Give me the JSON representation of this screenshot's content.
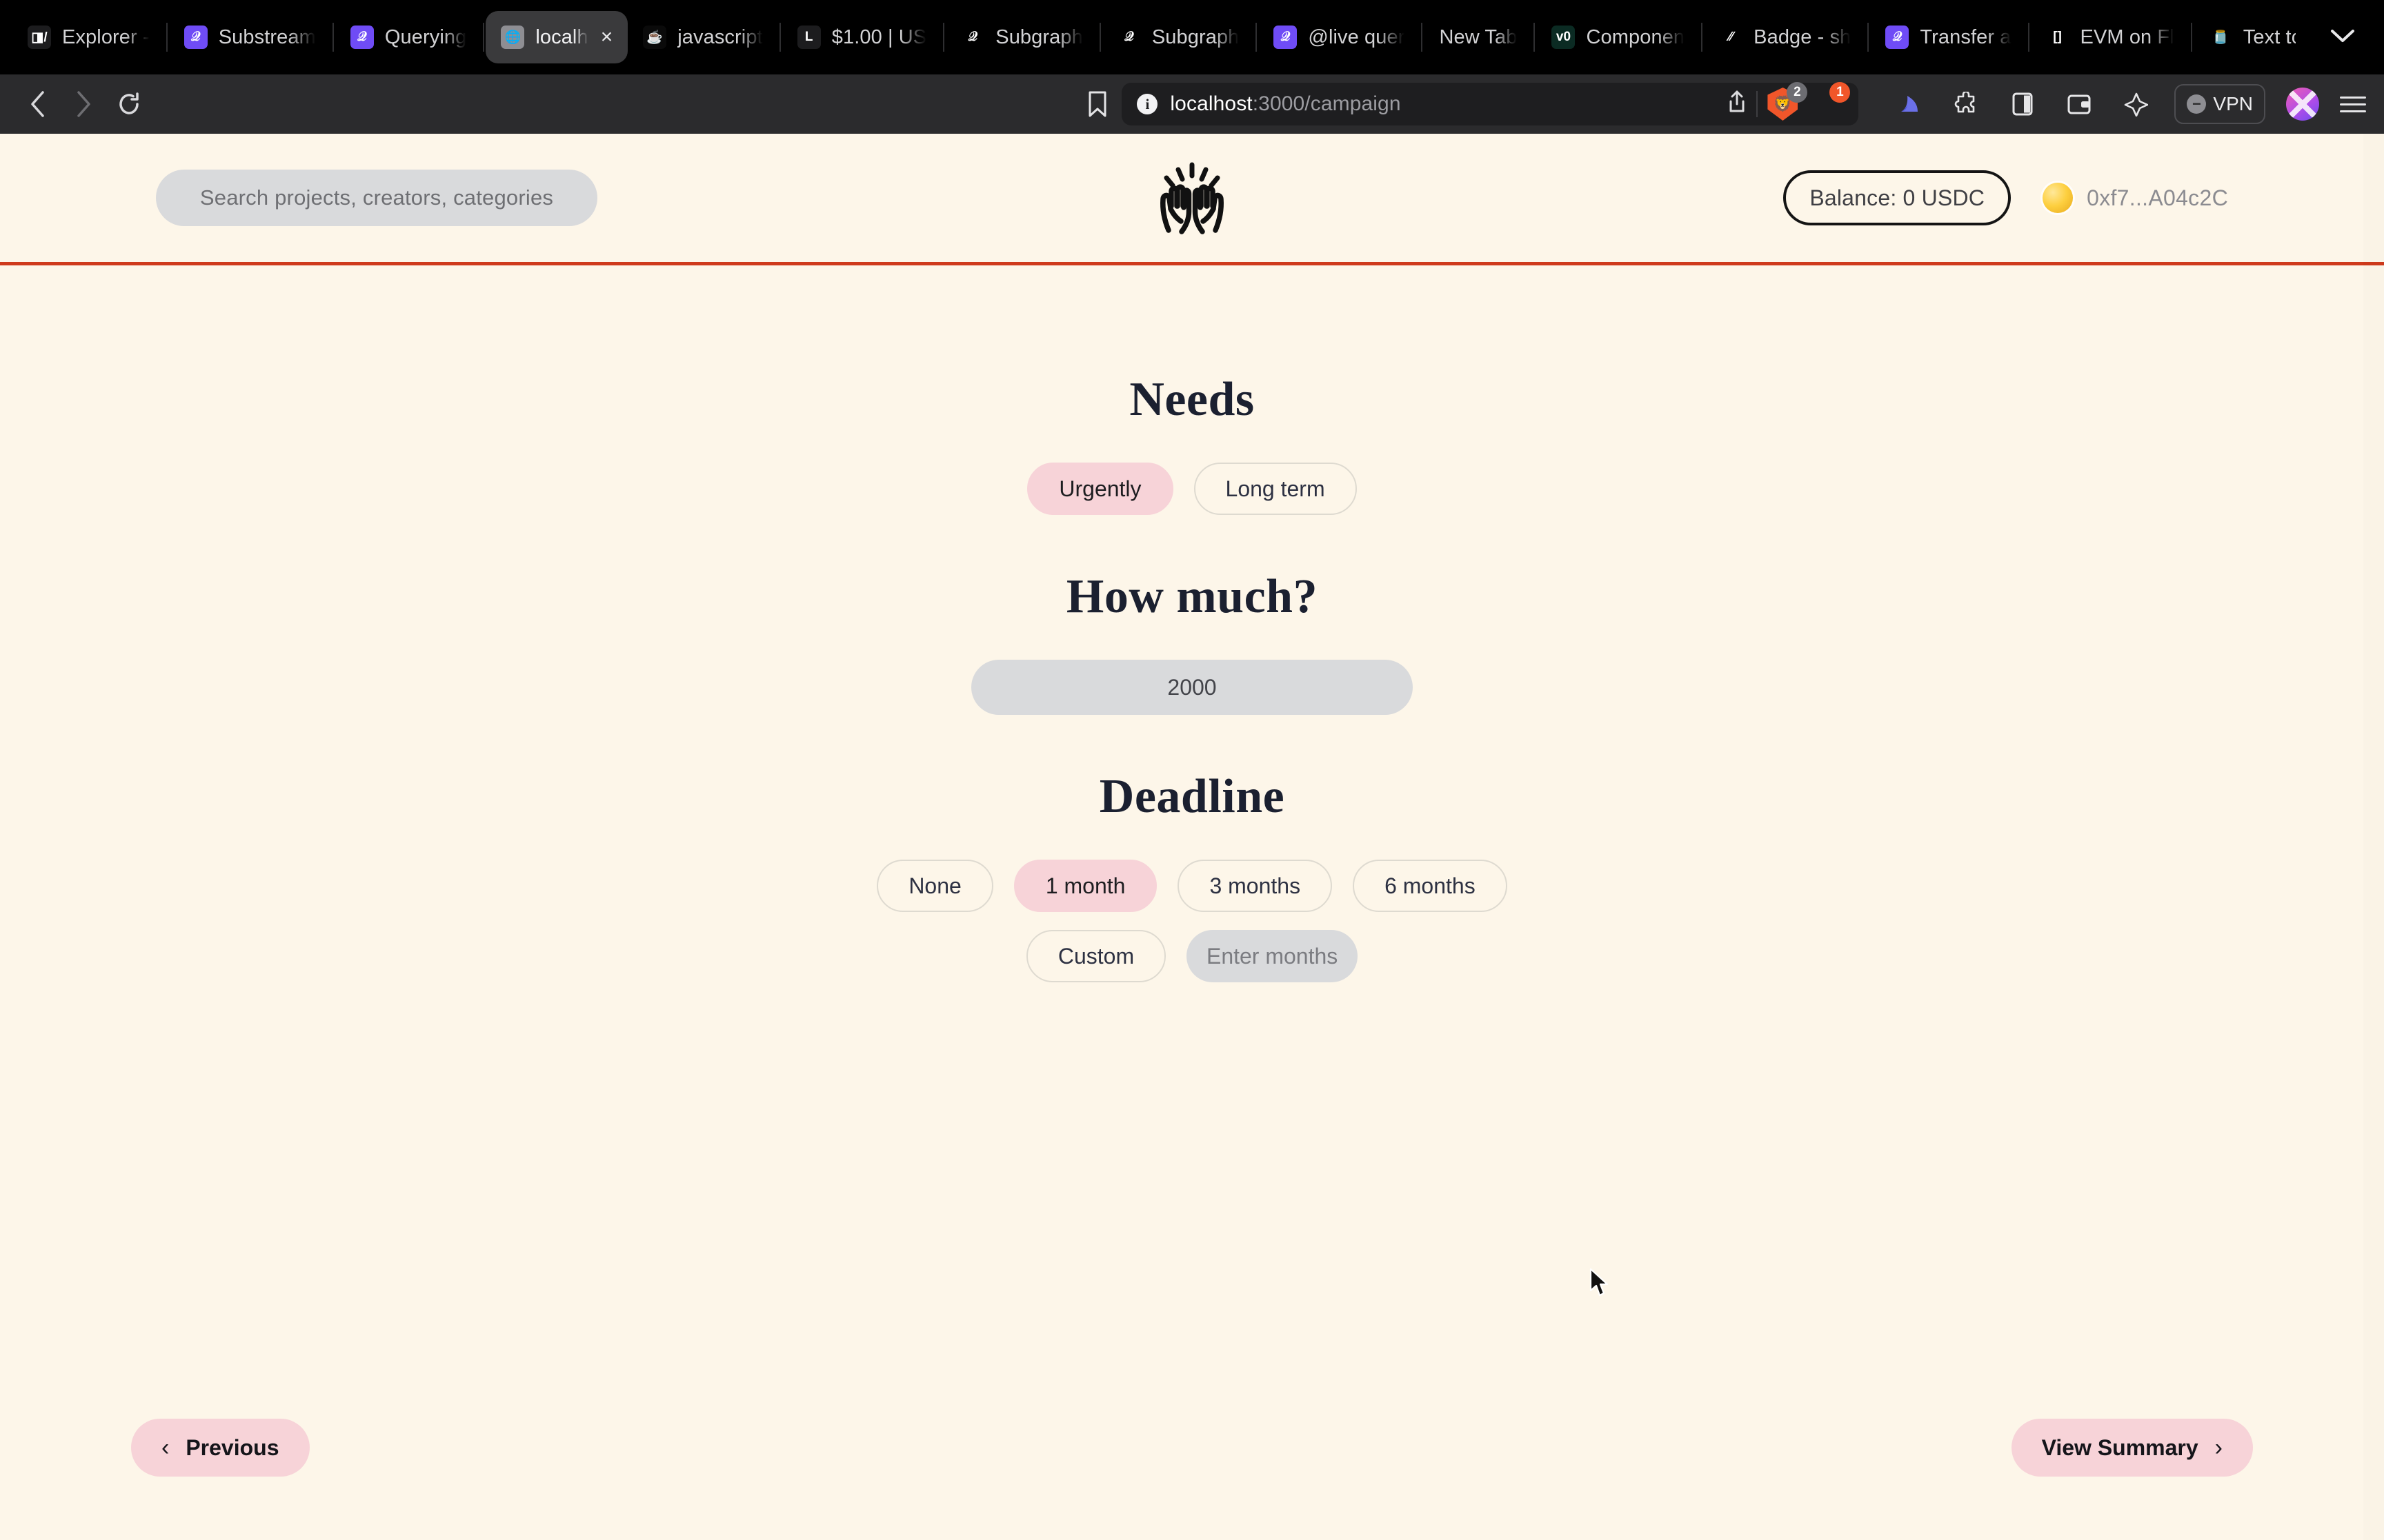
{
  "browser": {
    "tabs": [
      {
        "label": "Explorer -",
        "icon": "explorer-icon",
        "active": false
      },
      {
        "label": "Substream",
        "icon": "thegraph-icon",
        "active": false
      },
      {
        "label": "Querying",
        "icon": "thegraph-icon",
        "active": false
      },
      {
        "label": "localh",
        "icon": "globe-icon",
        "active": true,
        "close": "×"
      },
      {
        "label": "javascript",
        "icon": "java-icon",
        "active": false
      },
      {
        "label": "$1.00 | US",
        "icon": "l-icon",
        "active": false
      },
      {
        "label": "Subgraph",
        "icon": "thegraph-dark-icon",
        "active": false
      },
      {
        "label": "Subgraph",
        "icon": "thegraph-dark-icon",
        "active": false
      },
      {
        "label": "@live quer",
        "icon": "thegraph-icon",
        "active": false
      },
      {
        "label": "New Tab",
        "icon": "blank-icon",
        "active": false
      },
      {
        "label": "Componen",
        "icon": "v0-icon",
        "active": false
      },
      {
        "label": "Badge - sh",
        "icon": "slash-icon",
        "active": false
      },
      {
        "label": "Transfer a",
        "icon": "thegraph-icon",
        "active": false
      },
      {
        "label": "EVM on Fl",
        "icon": "flow-icon",
        "active": false
      },
      {
        "label": "Text to On",
        "icon": "jam-icon",
        "active": false
      }
    ],
    "new_tab_label": "+",
    "tab_list_chevron": "⌄",
    "nav": {
      "back": "‹",
      "forward": "›",
      "reload": "⟳"
    },
    "bookmark_icon": "bookmark-icon",
    "url": {
      "host": "localhost",
      "rest": ":3000/campaign"
    },
    "share_icon": "share-icon",
    "extensions": [
      {
        "name": "brave-shields-icon",
        "badge": "2"
      },
      {
        "name": "brave-rewards-icon",
        "badge": "1"
      }
    ],
    "toolbar_icons": [
      "leo-ai-icon",
      "extensions-puzzle-icon",
      "sidebar-panel-icon",
      "wallet-icon",
      "sparkle-icon"
    ],
    "vpn_label": "VPN",
    "menu_icon": "hamburger-menu-icon"
  },
  "site": {
    "search": {
      "placeholder": "Search projects, creators, categories"
    },
    "logo": "raising-hands-icon",
    "balance_label": "Balance: 0 USDC",
    "wallet_address": "0xf7...A04c2C"
  },
  "main": {
    "sections": [
      {
        "title": "Needs",
        "options": [
          {
            "label": "Urgently",
            "selected": true
          },
          {
            "label": "Long term",
            "selected": false
          }
        ]
      },
      {
        "title": "How much?",
        "amount_value": "2000"
      },
      {
        "title": "Deadline",
        "options_row1": [
          {
            "label": "None",
            "selected": false
          },
          {
            "label": "1 month",
            "selected": true
          },
          {
            "label": "3 months",
            "selected": false
          },
          {
            "label": "6 months",
            "selected": false
          }
        ],
        "options_row2": [
          {
            "label": "Custom",
            "selected": false
          }
        ],
        "custom_months_placeholder": "Enter months"
      }
    ]
  },
  "footer": {
    "previous_label": "Previous",
    "previous_arrow": "‹",
    "summary_label": "View Summary",
    "summary_arrow": "›"
  },
  "colors": {
    "page_bg": "#fdf6e9",
    "accent_pink": "#f7d3d8",
    "rule_red": "#cf3a1c",
    "input_grey": "#d9dadc",
    "heading": "#1b2030"
  }
}
